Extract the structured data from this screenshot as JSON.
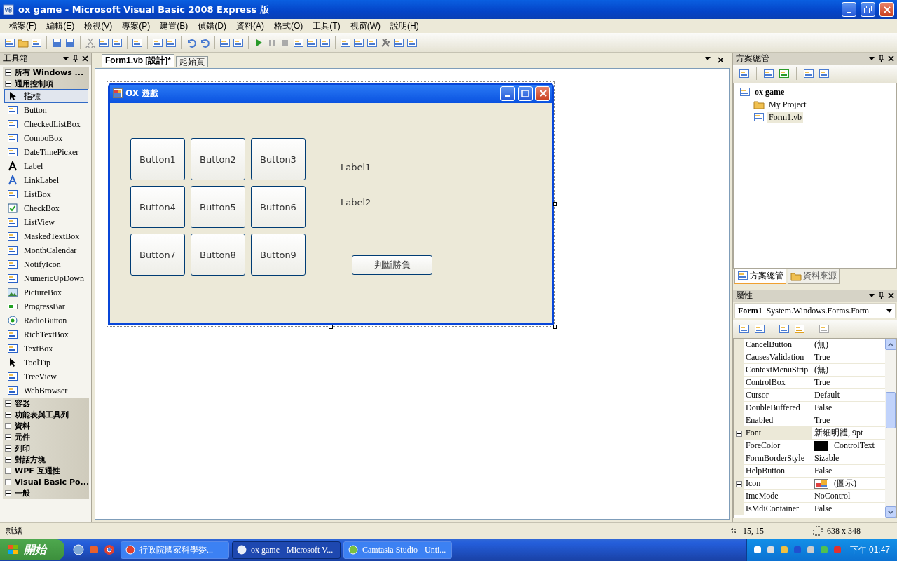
{
  "window": {
    "title": "ox game - Microsoft Visual Basic 2008 Express 版"
  },
  "menu": [
    "檔案(F)",
    "編輯(E)",
    "檢視(V)",
    "專案(P)",
    "建置(B)",
    "偵錯(D)",
    "資料(A)",
    "格式(O)",
    "工具(T)",
    "視窗(W)",
    "說明(H)"
  ],
  "toolbox": {
    "title": "工具箱",
    "sections": [
      {
        "label": "所有 Windows ...",
        "expanded": false
      },
      {
        "label": "通用控制項",
        "expanded": true,
        "items": [
          {
            "label": "指標",
            "selected": true
          },
          {
            "label": "Button",
            "selected": false
          },
          {
            "label": "CheckedListBox",
            "selected": false
          },
          {
            "label": "ComboBox",
            "selected": false
          },
          {
            "label": "DateTimePicker",
            "selected": false
          },
          {
            "label": "Label",
            "selected": false
          },
          {
            "label": "LinkLabel",
            "selected": false
          },
          {
            "label": "ListBox",
            "selected": false
          },
          {
            "label": "CheckBox",
            "selected": false
          },
          {
            "label": "ListView",
            "selected": false
          },
          {
            "label": "MaskedTextBox",
            "selected": false
          },
          {
            "label": "MonthCalendar",
            "selected": false
          },
          {
            "label": "NotifyIcon",
            "selected": false
          },
          {
            "label": "NumericUpDown",
            "selected": false
          },
          {
            "label": "PictureBox",
            "selected": false
          },
          {
            "label": "ProgressBar",
            "selected": false
          },
          {
            "label": "RadioButton",
            "selected": false
          },
          {
            "label": "RichTextBox",
            "selected": false
          },
          {
            "label": "TextBox",
            "selected": false
          },
          {
            "label": "ToolTip",
            "selected": false
          },
          {
            "label": "TreeView",
            "selected": false
          },
          {
            "label": "WebBrowser",
            "selected": false
          }
        ]
      },
      {
        "label": "容器",
        "expanded": false
      },
      {
        "label": "功能表與工具列",
        "expanded": false
      },
      {
        "label": "資料",
        "expanded": false
      },
      {
        "label": "元件",
        "expanded": false
      },
      {
        "label": "列印",
        "expanded": false
      },
      {
        "label": "對話方塊",
        "expanded": false
      },
      {
        "label": "WPF 互通性",
        "expanded": false
      },
      {
        "label": "Visual Basic Po...",
        "expanded": false
      },
      {
        "label": "一般",
        "expanded": false
      }
    ]
  },
  "document_tabs": [
    {
      "label": "Form1.vb [設計]*",
      "selected": true
    },
    {
      "label": "起始頁",
      "selected": false
    }
  ],
  "form": {
    "title": "OX 遊戲",
    "buttons": [
      "Button1",
      "Button2",
      "Button3",
      "Button4",
      "Button5",
      "Button6",
      "Button7",
      "Button8",
      "Button9"
    ],
    "labels": [
      "Label1",
      "Label2"
    ],
    "action_button": "判斷勝負"
  },
  "solution_explorer": {
    "title": "方案總管",
    "project": "ox game",
    "children": [
      {
        "label": "My Project",
        "selected": false
      },
      {
        "label": "Form1.vb",
        "selected": true
      }
    ],
    "tabs": [
      {
        "label": "方案總管",
        "selected": true
      },
      {
        "label": "資料來源",
        "selected": false
      }
    ]
  },
  "properties": {
    "title": "屬性",
    "object_name": "Form1",
    "object_type": "System.Windows.Forms.Form",
    "rows": [
      {
        "name": "CancelButton",
        "value": "(無)",
        "kind": "text",
        "expandable": false,
        "selected": false
      },
      {
        "name": "CausesValidation",
        "value": "True",
        "kind": "text",
        "expandable": false,
        "selected": false
      },
      {
        "name": "ContextMenuStrip",
        "value": "(無)",
        "kind": "text",
        "expandable": false,
        "selected": false
      },
      {
        "name": "ControlBox",
        "value": "True",
        "kind": "text",
        "expandable": false,
        "selected": false
      },
      {
        "name": "Cursor",
        "value": "Default",
        "kind": "text",
        "expandable": false,
        "selected": false
      },
      {
        "name": "DoubleBuffered",
        "value": "False",
        "kind": "text",
        "expandable": false,
        "selected": false
      },
      {
        "name": "Enabled",
        "value": "True",
        "kind": "text",
        "expandable": false,
        "selected": false
      },
      {
        "name": "Font",
        "value": "新細明體, 9pt",
        "kind": "text",
        "expandable": true,
        "selected": true
      },
      {
        "name": "ForeColor",
        "value": "ControlText",
        "kind": "color",
        "expandable": false,
        "selected": false
      },
      {
        "name": "FormBorderStyle",
        "value": "Sizable",
        "kind": "text",
        "expandable": false,
        "selected": false
      },
      {
        "name": "HelpButton",
        "value": "False",
        "kind": "text",
        "expandable": false,
        "selected": false
      },
      {
        "name": "Icon",
        "value": "(圖示)",
        "kind": "icon",
        "expandable": true,
        "selected": false
      },
      {
        "name": "ImeMode",
        "value": "NoControl",
        "kind": "text",
        "expandable": false,
        "selected": false
      },
      {
        "name": "IsMdiContainer",
        "value": "False",
        "kind": "text",
        "expandable": false,
        "selected": false
      }
    ]
  },
  "status_bar": {
    "text": "就緒",
    "position": "15, 15",
    "size": "638 x 348"
  },
  "taskbar": {
    "start": "開始",
    "tasks": [
      {
        "label": "行政院國家科學委...",
        "selected": false
      },
      {
        "label": "ox game - Microsoft V...",
        "selected": true
      },
      {
        "label": "Camtasia Studio - Unti...",
        "selected": false
      }
    ],
    "clock": "下午 01:47"
  }
}
